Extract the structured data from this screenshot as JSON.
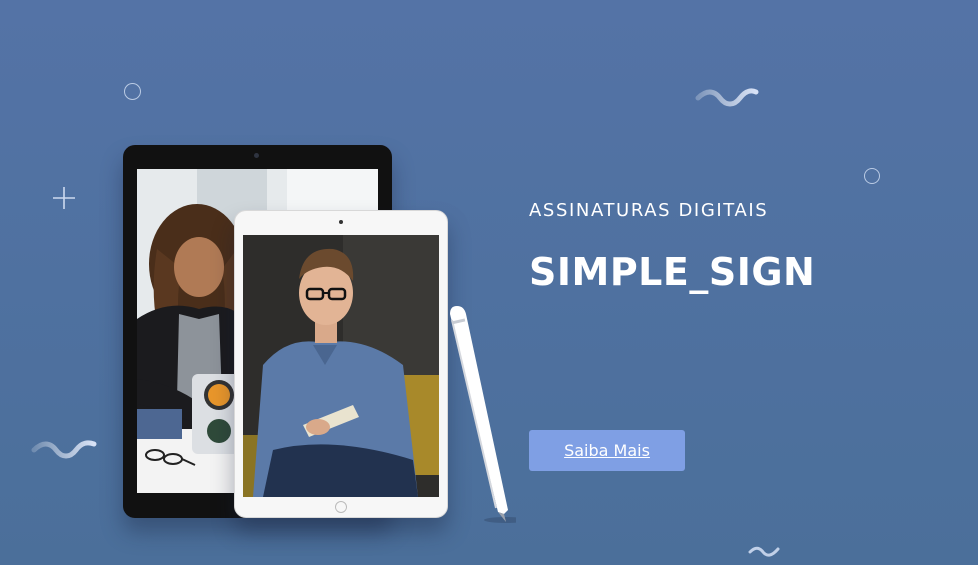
{
  "hero": {
    "eyebrow": "ASSINATURAS DIGITAIS",
    "title": "SIMPLE_SIGN",
    "cta_label": "Saiba Mais"
  },
  "images": {
    "dark_tablet_photo": "woman-with-laptop-photo",
    "white_tablet_photo": "man-writing-notebook-photo"
  },
  "colors": {
    "background": "#5070a2",
    "button": "#7f9fe4",
    "text": "#ffffff",
    "decoration": "#cddaf0"
  }
}
